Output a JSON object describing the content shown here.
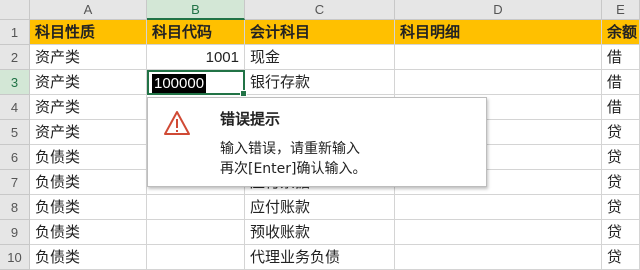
{
  "columns": [
    "A",
    "B",
    "C",
    "D",
    "E"
  ],
  "rows": [
    {
      "n": "1",
      "a": "科目性质",
      "b": "科目代码",
      "c": "会计科目",
      "d": "科目明细",
      "e": "余额"
    },
    {
      "n": "2",
      "a": "资产类",
      "b": "1001",
      "c": "现金",
      "d": "",
      "e": "借"
    },
    {
      "n": "3",
      "a": "资产类",
      "b": "",
      "c": "银行存款",
      "d": "",
      "e": "借"
    },
    {
      "n": "4",
      "a": "资产类",
      "b": "",
      "c": "",
      "d": "",
      "e": "借"
    },
    {
      "n": "5",
      "a": "资产类",
      "b": "",
      "c": "",
      "d": "",
      "e": "贷"
    },
    {
      "n": "6",
      "a": "负债类",
      "b": "",
      "c": "",
      "d": "",
      "e": "贷"
    },
    {
      "n": "7",
      "a": "负债类",
      "b": "",
      "c": "应付票据",
      "d": "",
      "e": "贷"
    },
    {
      "n": "8",
      "a": "负债类",
      "b": "",
      "c": "应付账款",
      "d": "",
      "e": "贷"
    },
    {
      "n": "9",
      "a": "负债类",
      "b": "",
      "c": "预收账款",
      "d": "",
      "e": "贷"
    },
    {
      "n": "10",
      "a": "负债类",
      "b": "",
      "c": "代理业务负债",
      "d": "",
      "e": "贷"
    }
  ],
  "active_cell": {
    "value": "100000"
  },
  "error_tip": {
    "title": "错误提示",
    "line1": "输入错误，请重新输入",
    "line2": "再次[Enter]确认输入。"
  },
  "colors": {
    "header_fill": "#ffc000",
    "selection": "#217346"
  }
}
